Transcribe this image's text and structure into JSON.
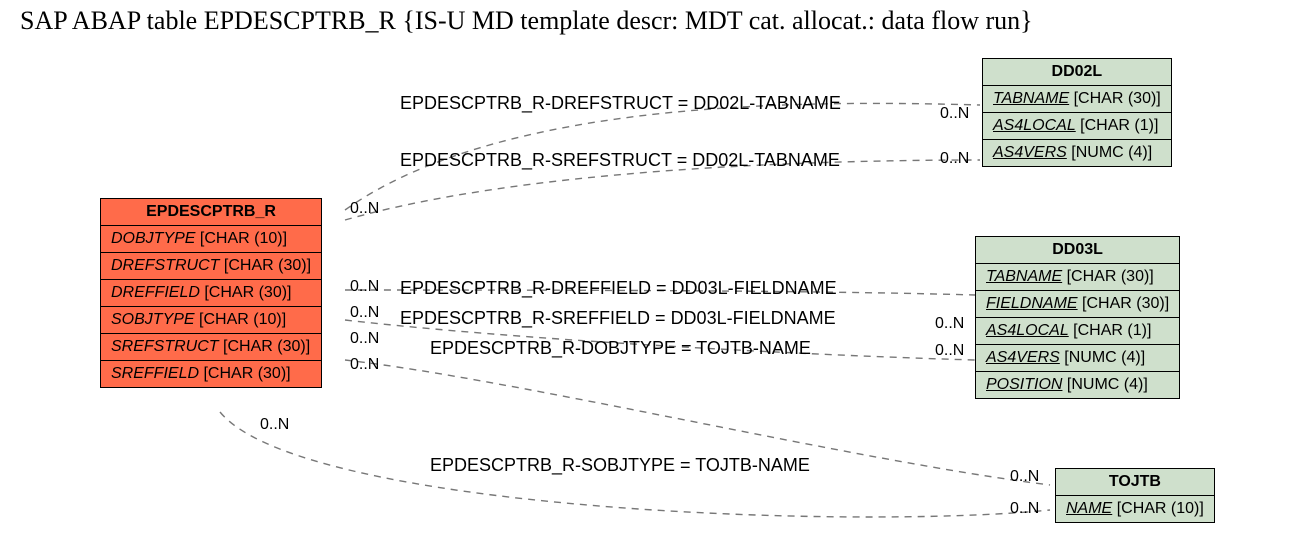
{
  "title": "SAP ABAP table EPDESCPTRB_R {IS-U MD template descr: MDT cat. allocat.: data flow run}",
  "entities": {
    "source": {
      "name": "EPDESCPTRB_R",
      "fields": [
        {
          "name": "DOBJTYPE",
          "type": "[CHAR (10)]"
        },
        {
          "name": "DREFSTRUCT",
          "type": "[CHAR (30)]"
        },
        {
          "name": "DREFFIELD",
          "type": "[CHAR (30)]"
        },
        {
          "name": "SOBJTYPE",
          "type": "[CHAR (10)]"
        },
        {
          "name": "SREFSTRUCT",
          "type": "[CHAR (30)]"
        },
        {
          "name": "SREFFIELD",
          "type": "[CHAR (30)]"
        }
      ]
    },
    "dd02l": {
      "name": "DD02L",
      "fields": [
        {
          "name": "TABNAME",
          "type": "[CHAR (30)]"
        },
        {
          "name": "AS4LOCAL",
          "type": "[CHAR (1)]"
        },
        {
          "name": "AS4VERS",
          "type": "[NUMC (4)]"
        }
      ]
    },
    "dd03l": {
      "name": "DD03L",
      "fields": [
        {
          "name": "TABNAME",
          "type": "[CHAR (30)]"
        },
        {
          "name": "FIELDNAME",
          "type": "[CHAR (30)]"
        },
        {
          "name": "AS4LOCAL",
          "type": "[CHAR (1)]"
        },
        {
          "name": "AS4VERS",
          "type": "[NUMC (4)]"
        },
        {
          "name": "POSITION",
          "type": "[NUMC (4)]"
        }
      ]
    },
    "tojtb": {
      "name": "TOJTB",
      "fields": [
        {
          "name": "NAME",
          "type": "[CHAR (10)]"
        }
      ]
    }
  },
  "relations": {
    "r1": "EPDESCPTRB_R-DREFSTRUCT = DD02L-TABNAME",
    "r2": "EPDESCPTRB_R-SREFSTRUCT = DD02L-TABNAME",
    "r3": "EPDESCPTRB_R-DREFFIELD = DD03L-FIELDNAME",
    "r4": "EPDESCPTRB_R-SREFFIELD = DD03L-FIELDNAME",
    "r5": "EPDESCPTRB_R-DOBJTYPE = TOJTB-NAME",
    "r6": "EPDESCPTRB_R-SOBJTYPE = TOJTB-NAME"
  },
  "card": "0..N"
}
